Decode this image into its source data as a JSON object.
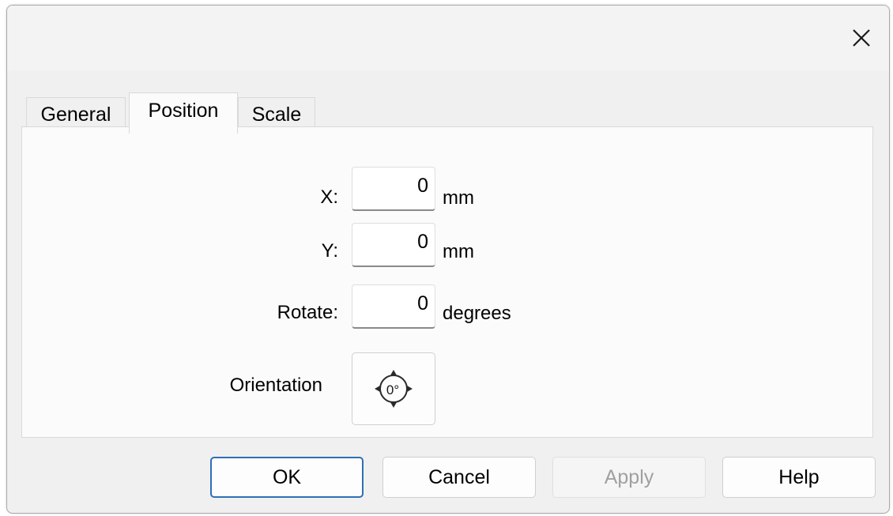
{
  "titlebar": {
    "close_icon": "close-icon"
  },
  "tabs": [
    {
      "label": "General",
      "active": false
    },
    {
      "label": "Position",
      "active": true
    },
    {
      "label": "Scale",
      "active": false
    }
  ],
  "position": {
    "x": {
      "label": "X:",
      "value": "0",
      "unit": "mm"
    },
    "y": {
      "label": "Y:",
      "value": "0",
      "unit": "mm"
    },
    "rotate": {
      "label": "Rotate:",
      "value": "0",
      "unit": "degrees"
    },
    "orientation": {
      "label": "Orientation",
      "icon": "rotation-0-degrees-icon",
      "icon_text": "0°"
    }
  },
  "buttons": {
    "ok": "OK",
    "cancel": "Cancel",
    "apply": "Apply",
    "help": "Help"
  },
  "colors": {
    "primary_border": "#2f6fb6",
    "disabled_text": "#a0a0a0"
  }
}
